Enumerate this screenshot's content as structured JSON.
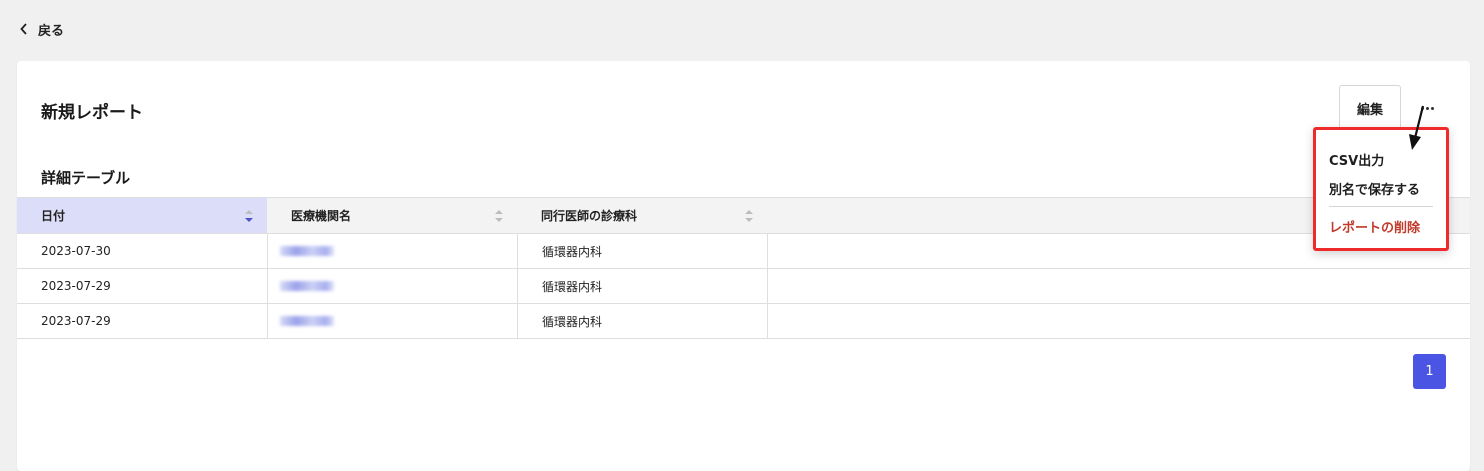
{
  "nav": {
    "back_label": "戻る"
  },
  "header": {
    "title": "新規レポート",
    "edit_label": "編集"
  },
  "section": {
    "title": "詳細テーブル"
  },
  "table": {
    "columns": [
      "日付",
      "医療機関名",
      "同行医師の診療科"
    ],
    "rows": [
      {
        "date": "2023-07-30",
        "facility": "",
        "department": "循環器内科"
      },
      {
        "date": "2023-07-29",
        "facility": "",
        "department": "循環器内科"
      },
      {
        "date": "2023-07-29",
        "facility": "",
        "department": "循環器内科"
      }
    ]
  },
  "pagination": {
    "current_page": "1"
  },
  "menu": {
    "items": [
      "CSV出力",
      "別名で保存する"
    ],
    "danger_item": "レポートの削除"
  },
  "colors": {
    "accent": "#4a55e3",
    "active_header": "#dcddf9",
    "highlight_border": "#ee2a2a",
    "danger": "#c0392b"
  },
  "icons": [
    "chevron-left-icon",
    "more-horizontal-icon",
    "sort-icon",
    "pointer-arrow-icon"
  ]
}
